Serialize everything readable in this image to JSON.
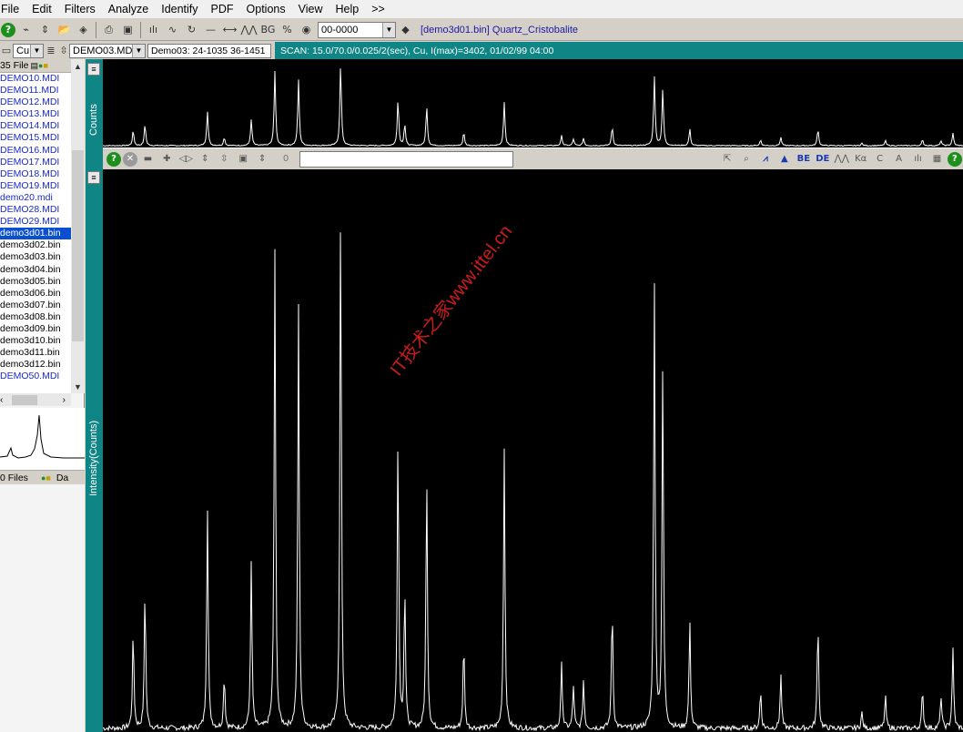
{
  "menu": [
    "File",
    "Edit",
    "Filters",
    "Analyze",
    "Identify",
    "PDF",
    "Options",
    "View",
    "Help",
    ">>"
  ],
  "toolbar1": {
    "combo_value": "00-0000",
    "title": "[demo3d01.bin] Quartz_Cristobalite"
  },
  "toolbar2": {
    "anode": "Cu",
    "file_combo": "DEMO03.MDI",
    "pattern": "Demo03: 24-1035 36-1451",
    "scan_info": "SCAN: 15.0/70.0/0.025/2(sec), Cu, I(max)=3402, 01/02/99 04:00"
  },
  "file_panel": {
    "header": "35 File",
    "files": [
      {
        "name": "DEMO10.MDI",
        "kind": "mdi"
      },
      {
        "name": "DEMO11.MDI",
        "kind": "mdi"
      },
      {
        "name": "DEMO12.MDI",
        "kind": "mdi"
      },
      {
        "name": "DEMO13.MDI",
        "kind": "mdi"
      },
      {
        "name": "DEMO14.MDI",
        "kind": "mdi"
      },
      {
        "name": "DEMO15.MDI",
        "kind": "mdi"
      },
      {
        "name": "DEMO16.MDI",
        "kind": "mdi"
      },
      {
        "name": "DEMO17.MDI",
        "kind": "mdi"
      },
      {
        "name": "DEMO18.MDI",
        "kind": "mdi"
      },
      {
        "name": "DEMO19.MDI",
        "kind": "mdi"
      },
      {
        "name": "demo20.mdi",
        "kind": "mdi"
      },
      {
        "name": "DEMO28.MDI",
        "kind": "mdi"
      },
      {
        "name": "DEMO29.MDI",
        "kind": "mdi"
      },
      {
        "name": "demo3d01.bin",
        "kind": "sel"
      },
      {
        "name": "demo3d02.bin",
        "kind": "bin"
      },
      {
        "name": "demo3d03.bin",
        "kind": "bin"
      },
      {
        "name": "demo3d04.bin",
        "kind": "bin"
      },
      {
        "name": "demo3d05.bin",
        "kind": "bin"
      },
      {
        "name": "demo3d06.bin",
        "kind": "bin"
      },
      {
        "name": "demo3d07.bin",
        "kind": "bin"
      },
      {
        "name": "demo3d08.bin",
        "kind": "bin"
      },
      {
        "name": "demo3d09.bin",
        "kind": "bin"
      },
      {
        "name": "demo3d10.bin",
        "kind": "bin"
      },
      {
        "name": "demo3d11.bin",
        "kind": "bin"
      },
      {
        "name": "demo3d12.bin",
        "kind": "bin"
      },
      {
        "name": "DEMO50.MDI",
        "kind": "mdi"
      }
    ],
    "footer_left": "0 Files",
    "footer_right": "Da"
  },
  "axis": {
    "overview_label": "Counts",
    "main_label": "Intensity(Counts)"
  },
  "plot_toolbar": {
    "zero": "0"
  },
  "watermark": "IT技术之家www.ittel.cn",
  "colors": {
    "teal": "#0f8585",
    "plot_bg": "#000000",
    "trace": "#ffffff",
    "mdi_text": "#1a2ad0",
    "selection": "#0a4fd0"
  },
  "pattern_peaks": [
    {
      "two_theta": 20.8,
      "rel": 0.18
    },
    {
      "two_theta": 21.5,
      "rel": 0.26
    },
    {
      "two_theta": 25.2,
      "rel": 0.42
    },
    {
      "two_theta": 26.2,
      "rel": 0.1
    },
    {
      "two_theta": 27.8,
      "rel": 0.31
    },
    {
      "two_theta": 29.2,
      "rel": 0.9
    },
    {
      "two_theta": 30.6,
      "rel": 0.8
    },
    {
      "two_theta": 33.1,
      "rel": 1.0
    },
    {
      "two_theta": 36.5,
      "rel": 0.56
    },
    {
      "two_theta": 36.9,
      "rel": 0.26
    },
    {
      "two_theta": 38.2,
      "rel": 0.48
    },
    {
      "two_theta": 40.4,
      "rel": 0.16
    },
    {
      "two_theta": 42.8,
      "rel": 0.53
    },
    {
      "two_theta": 46.2,
      "rel": 0.12
    },
    {
      "two_theta": 46.9,
      "rel": 0.08
    },
    {
      "two_theta": 47.5,
      "rel": 0.09
    },
    {
      "two_theta": 49.2,
      "rel": 0.23
    },
    {
      "two_theta": 51.7,
      "rel": 0.84
    },
    {
      "two_theta": 52.2,
      "rel": 0.68
    },
    {
      "two_theta": 53.8,
      "rel": 0.2
    },
    {
      "two_theta": 58.0,
      "rel": 0.07
    },
    {
      "two_theta": 59.2,
      "rel": 0.1
    },
    {
      "two_theta": 61.4,
      "rel": 0.2
    },
    {
      "two_theta": 64.0,
      "rel": 0.03
    },
    {
      "two_theta": 65.4,
      "rel": 0.06
    },
    {
      "two_theta": 67.6,
      "rel": 0.07
    },
    {
      "two_theta": 68.7,
      "rel": 0.06
    },
    {
      "two_theta": 69.4,
      "rel": 0.15
    }
  ],
  "pattern_range": [
    19.0,
    70.0
  ]
}
